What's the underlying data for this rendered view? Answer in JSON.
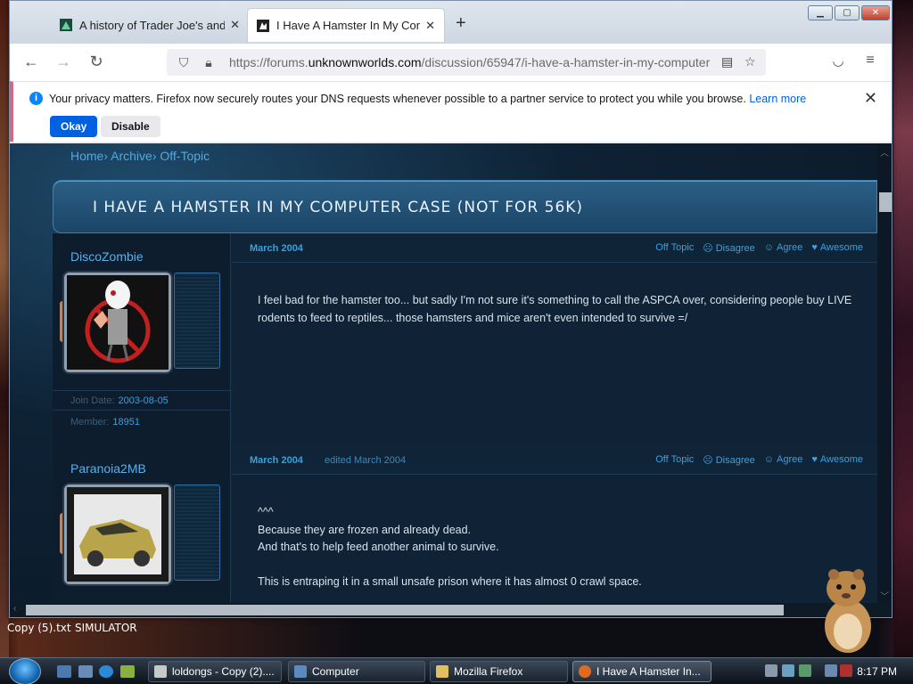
{
  "browser": {
    "tabs": [
      {
        "title": "A history of Trader Joe's and Joe",
        "active": false
      },
      {
        "title": "I Have A Hamster In My Compu",
        "active": true
      }
    ],
    "url_prefix": "https://forums.",
    "url_domain": "unknownworlds.com",
    "url_path": "/discussion/65947/i-have-a-hamster-in-my-computer"
  },
  "notice": {
    "message": "Your privacy matters. Firefox now securely routes your DNS requests whenever possible to a partner service to protect you while you browse.",
    "learn_more": "Learn more",
    "okay": "Okay",
    "disable": "Disable"
  },
  "page": {
    "breadcrumb": [
      {
        "label": "Home"
      },
      {
        "label": "Archive"
      },
      {
        "label": "Off-Topic"
      }
    ],
    "title": "I HAVE A HAMSTER IN MY COMPUTER CASE (NOT FOR 56K)",
    "posts": [
      {
        "username": "DiscoZombie",
        "date": "March 2004",
        "edited": "",
        "join_label": "Join Date:",
        "join_date": "2003-08-05",
        "member_label": "Member:",
        "member_no": "18951",
        "reactions": [
          "Off Topic",
          "Disagree",
          "Agree",
          "Awesome"
        ],
        "body": "I feel bad for the hamster too... but sadly I'm not sure it's something to call the ASPCA over, considering people buy LIVE rodents to feed to reptiles... those hamsters and mice aren't even intended to survive =/"
      },
      {
        "username": "Paranoia2MB",
        "date": "March 2004",
        "edited": "edited March 2004",
        "reactions": [
          "Off Topic",
          "Disagree",
          "Agree",
          "Awesome"
        ],
        "body_lines": [
          "^^^",
          "Because they are frozen and already dead.",
          "And that's to help feed another animal to survive.",
          "",
          "This is entraping it in a small unsafe prison where it has almost 0 crawl space."
        ]
      }
    ]
  },
  "desktop": {
    "labels": [
      "Copy (5).txt",
      "SIMULATOR"
    ]
  },
  "taskbar": {
    "tasks": [
      "loldongs - Copy (2)....",
      "Computer",
      "Mozilla Firefox",
      "I Have A Hamster In..."
    ],
    "clock": "8:17 PM"
  }
}
